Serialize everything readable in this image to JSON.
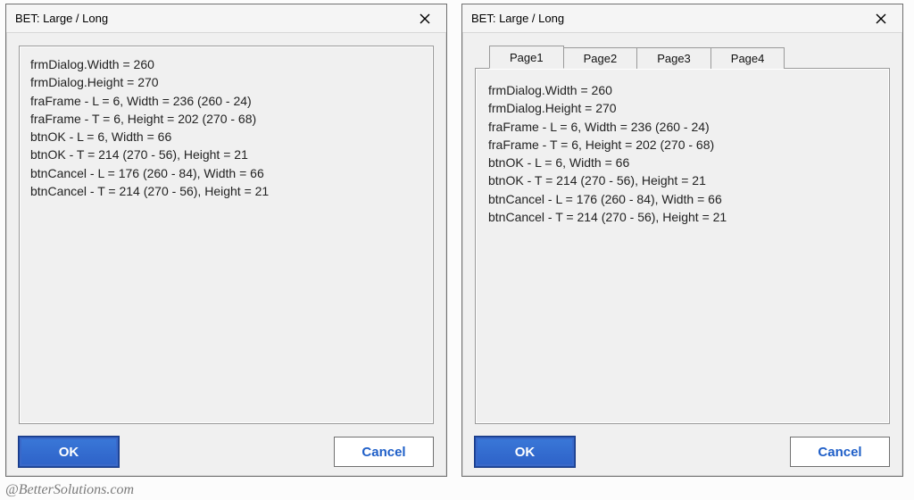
{
  "watermark": "@BetterSolutions.com",
  "dialogs": [
    {
      "title": "BET: Large / Long",
      "kind": "plain",
      "lines": [
        "frmDialog.Width = 260",
        "frmDialog.Height = 270",
        "fraFrame - L = 6, Width = 236 (260 - 24)",
        "fraFrame - T = 6, Height = 202 (270 - 68)",
        "btnOK - L = 6, Width = 66",
        "btnOK - T = 214 (270 - 56), Height = 21",
        "btnCancel - L = 176 (260 - 84), Width = 66",
        "btnCancel - T = 214 (270 - 56), Height = 21"
      ],
      "ok_label": "OK",
      "cancel_label": "Cancel"
    },
    {
      "title": "BET: Large / Long",
      "kind": "tabbed",
      "tabs": [
        "Page1",
        "Page2",
        "Page3",
        "Page4"
      ],
      "active_tab": 0,
      "lines": [
        "frmDialog.Width = 260",
        "frmDialog.Height = 270",
        "fraFrame - L = 6, Width = 236 (260 - 24)",
        "fraFrame - T = 6, Height = 202 (270 - 68)",
        "btnOK - L = 6, Width = 66",
        "btnOK - T = 214 (270 - 56), Height = 21",
        "btnCancel - L = 176 (260 - 84), Width = 66",
        "btnCancel - T = 214 (270 - 56), Height = 21"
      ],
      "ok_label": "OK",
      "cancel_label": "Cancel"
    }
  ]
}
